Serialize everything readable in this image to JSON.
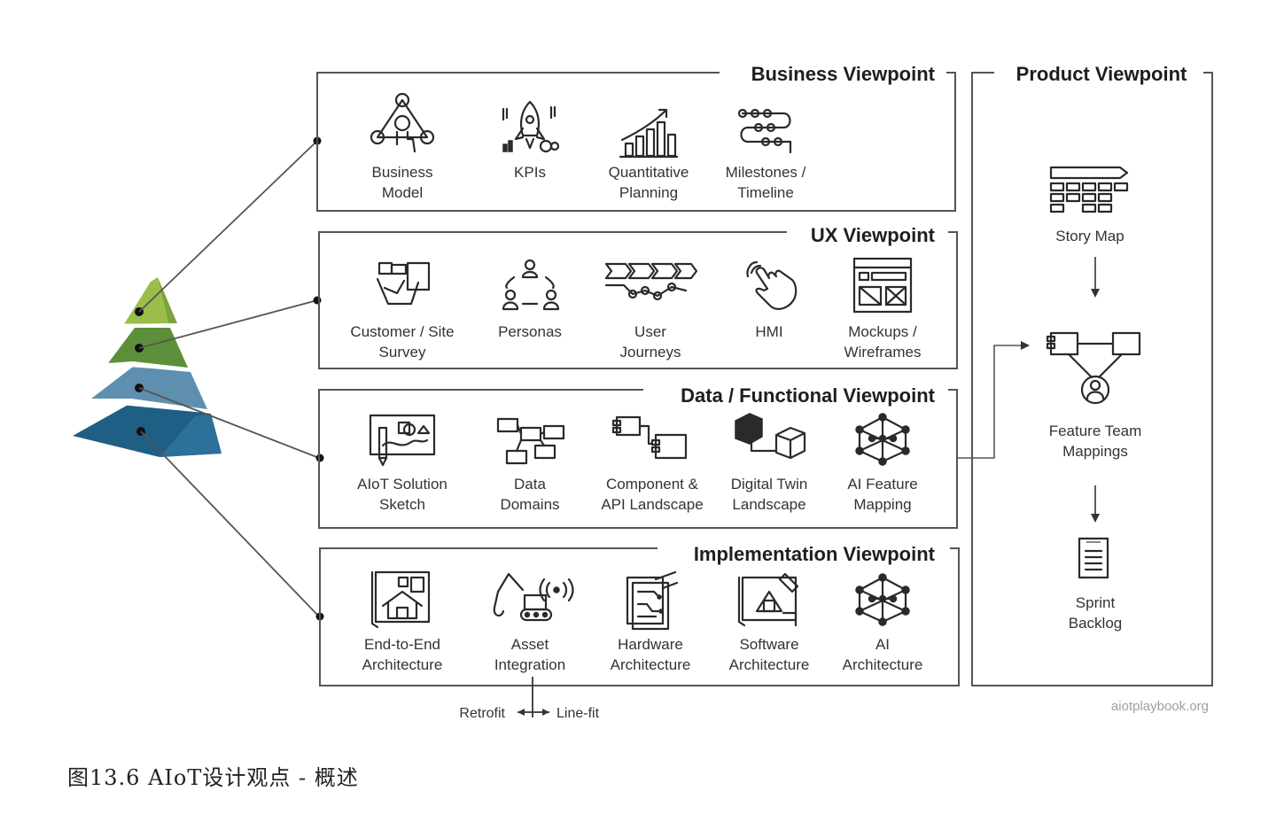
{
  "viewpoints": {
    "business": {
      "title": "Business Viewpoint",
      "items": [
        {
          "label1": "Business",
          "label2": "Model",
          "icon": "business-model-icon"
        },
        {
          "label1": "KPIs",
          "label2": "",
          "icon": "rocket-kpi-icon"
        },
        {
          "label1": "Quantitative",
          "label2": "Planning",
          "icon": "growth-chart-icon"
        },
        {
          "label1": "Milestones /",
          "label2": "Timeline",
          "icon": "timeline-icon"
        }
      ]
    },
    "ux": {
      "title": "UX Viewpoint",
      "items": [
        {
          "label1": "Customer / Site",
          "label2": "Survey",
          "icon": "survey-camera-icon"
        },
        {
          "label1": "Personas",
          "label2": "",
          "icon": "personas-icon"
        },
        {
          "label1": "User",
          "label2": "Journeys",
          "icon": "journey-arrows-icon"
        },
        {
          "label1": "HMI",
          "label2": "",
          "icon": "touch-hand-icon"
        },
        {
          "label1": "Mockups /",
          "label2": "Wireframes",
          "icon": "wireframe-icon"
        }
      ]
    },
    "data": {
      "title": "Data / Functional Viewpoint",
      "items": [
        {
          "label1": "AIoT Solution",
          "label2": "Sketch",
          "icon": "whiteboard-sketch-icon"
        },
        {
          "label1": "Data",
          "label2": "Domains",
          "icon": "data-domains-icon"
        },
        {
          "label1": "Component &",
          "label2": "API Landscape",
          "icon": "component-icon"
        },
        {
          "label1": "Digital Twin",
          "label2": "Landscape",
          "icon": "digital-twin-cubes-icon"
        },
        {
          "label1": "AI Feature",
          "label2": "Mapping",
          "icon": "neural-network-icon"
        }
      ]
    },
    "implementation": {
      "title": "Implementation Viewpoint",
      "items": [
        {
          "label1": "End-to-End",
          "label2": "Architecture",
          "icon": "house-blueprint-icon"
        },
        {
          "label1": "Asset",
          "label2": "Integration",
          "icon": "excavator-icon"
        },
        {
          "label1": "Hardware",
          "label2": "Architecture",
          "icon": "hardware-circuit-icon"
        },
        {
          "label1": "Software",
          "label2": "Architecture",
          "icon": "software-blueprint-icon"
        },
        {
          "label1": "AI",
          "label2": "Architecture",
          "icon": "neural-network-icon"
        }
      ],
      "retrofit_label": "Retrofit",
      "linefit_label": "Line-fit"
    },
    "product": {
      "title": "Product Viewpoint",
      "items": [
        {
          "label1": "Story Map",
          "label2": "",
          "icon": "story-map-icon"
        },
        {
          "label1": "Feature Team",
          "label2": "Mappings",
          "icon": "feature-team-icon"
        },
        {
          "label1": "Sprint",
          "label2": "Backlog",
          "icon": "backlog-document-icon"
        }
      ]
    }
  },
  "pyramid": {
    "colors": [
      "#9bbd4a",
      "#5d8f3a",
      "#5f8fae",
      "#1f5f86"
    ],
    "icon": "pyramid-icon"
  },
  "credit": "aiotplaybook.org",
  "caption": "图13.6 AIoT设计观点 - 概述"
}
